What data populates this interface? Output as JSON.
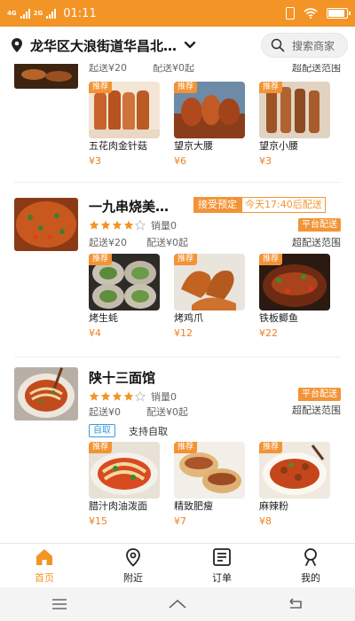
{
  "status_bar": {
    "network": "4G",
    "network2": "2G",
    "time": "01:11",
    "battery_level": 0.9
  },
  "header": {
    "location": "龙华区大浪街道华昌北…",
    "search_placeholder": "搜索商家"
  },
  "colors": {
    "brand": "#f39426",
    "price": "#f07f1f",
    "pickup": "#3a9bd9"
  },
  "stores": [
    {
      "name": "",
      "min_order": "起送¥20",
      "delivery_fee": "配送¥0起",
      "range": "超配送范围",
      "dishes": [
        {
          "tag": "推荐",
          "name": "五花肉金针菇",
          "price": "¥3"
        },
        {
          "tag": "推荐",
          "name": "望京大腰",
          "price": "¥6"
        },
        {
          "tag": "推荐",
          "name": "望京小腰",
          "price": "¥3"
        }
      ]
    },
    {
      "name": "一九串烧美…",
      "rating": 4,
      "sales": "销量0",
      "preorder": "接受预定",
      "preorder_time": "今天17:40后配送",
      "platform": "平台配送",
      "min_order": "起送¥20",
      "delivery_fee": "配送¥0起",
      "range": "超配送范围",
      "dishes": [
        {
          "tag": "推荐",
          "name": "烤生蚝",
          "price": "¥4"
        },
        {
          "tag": "推荐",
          "name": "烤鸡爪",
          "price": "¥12"
        },
        {
          "tag": "推荐",
          "name": "铁板鲫鱼",
          "price": "¥22"
        }
      ]
    },
    {
      "name": "陕十三面馆",
      "rating": 4,
      "sales": "销量0",
      "platform": "平台配送",
      "min_order": "起送¥0",
      "delivery_fee": "配送¥0起",
      "range": "超配送范围",
      "pickup_tag": "自取",
      "pickup_text": "支持自取",
      "dishes": [
        {
          "tag": "推荐",
          "name": "腊汁肉油泼面",
          "price": "¥15"
        },
        {
          "tag": "推荐",
          "name": "精致肥瘦",
          "price": "¥7"
        },
        {
          "tag": "推荐",
          "name": "麻辣粉",
          "price": "¥8"
        }
      ]
    }
  ],
  "bottom_nav": [
    {
      "label": "首页",
      "icon": "home-icon",
      "active": true
    },
    {
      "label": "附近",
      "icon": "map-pin-icon",
      "active": false
    },
    {
      "label": "订单",
      "icon": "order-list-icon",
      "active": false
    },
    {
      "label": "我的",
      "icon": "profile-icon",
      "active": false
    }
  ],
  "system_nav": [
    "menu-icon",
    "home-icon",
    "back-icon"
  ]
}
